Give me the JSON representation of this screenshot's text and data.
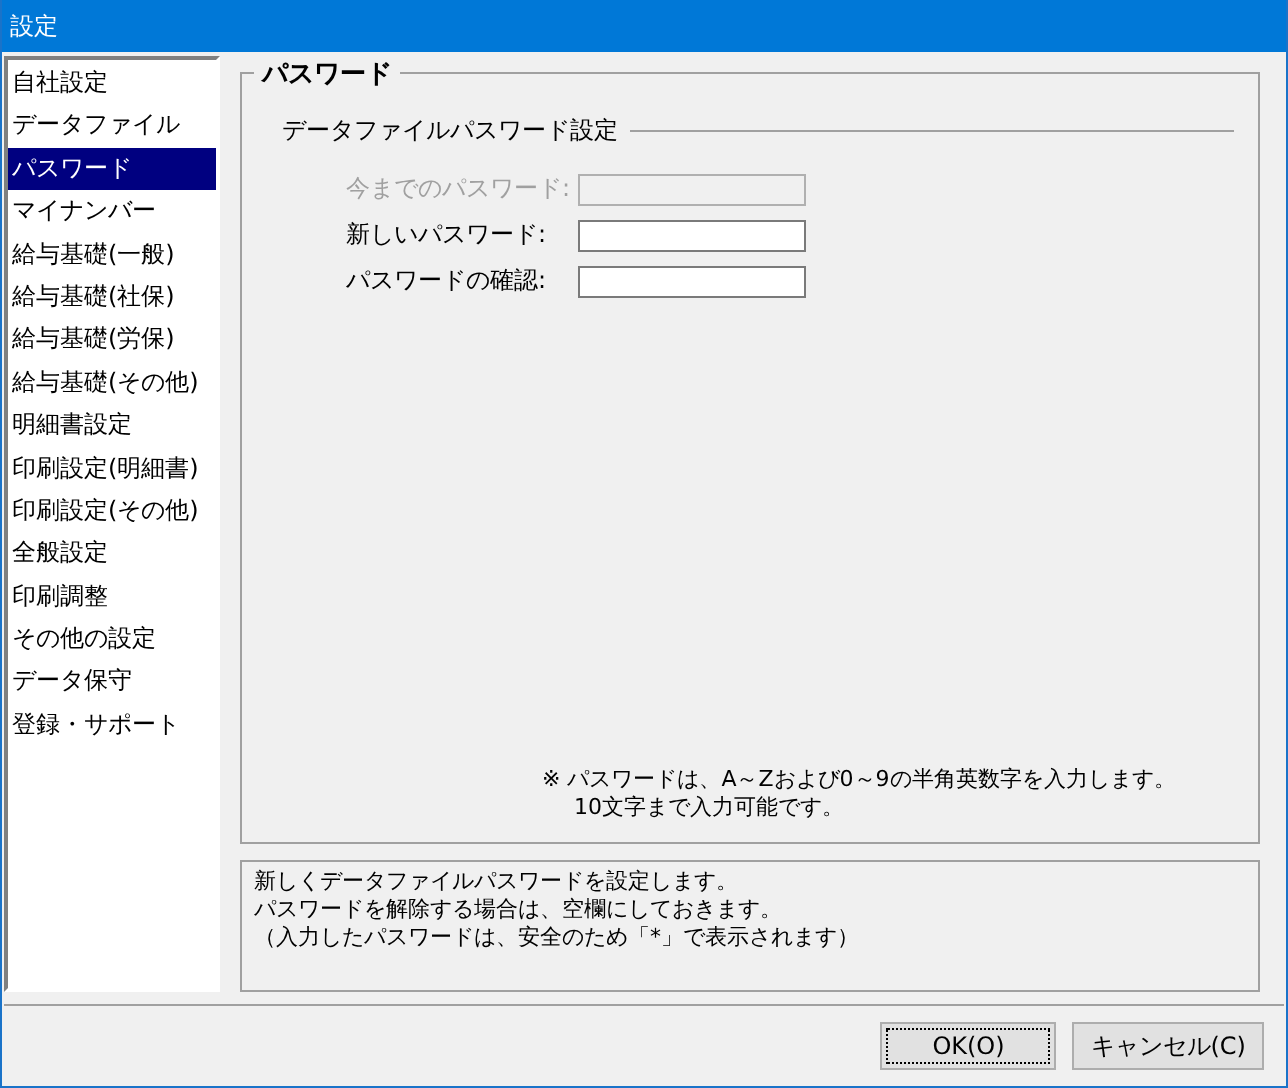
{
  "window": {
    "title": "設定"
  },
  "sidebar": {
    "items": [
      {
        "label": "自社設定",
        "selected": false
      },
      {
        "label": "データファイル",
        "selected": false
      },
      {
        "label": "パスワード",
        "selected": true
      },
      {
        "label": "マイナンバー",
        "selected": false
      },
      {
        "label": "給与基礎(一般)",
        "selected": false
      },
      {
        "label": "給与基礎(社保)",
        "selected": false
      },
      {
        "label": "給与基礎(労保)",
        "selected": false
      },
      {
        "label": "給与基礎(その他)",
        "selected": false
      },
      {
        "label": "明細書設定",
        "selected": false
      },
      {
        "label": "印刷設定(明細書)",
        "selected": false
      },
      {
        "label": "印刷設定(その他)",
        "selected": false
      },
      {
        "label": "全般設定",
        "selected": false
      },
      {
        "label": "印刷調整",
        "selected": false
      },
      {
        "label": "その他の設定",
        "selected": false
      },
      {
        "label": "データ保守",
        "selected": false
      },
      {
        "label": "登録・サポート",
        "selected": false
      }
    ]
  },
  "group": {
    "title": "パスワード",
    "section": "データファイルパスワード設定",
    "fields": [
      {
        "label": "今までのパスワード:",
        "disabled": true
      },
      {
        "label": "新しいパスワード:",
        "disabled": false
      },
      {
        "label": "パスワードの確認:",
        "disabled": false
      }
    ],
    "note": [
      "※ パスワードは、A～Zおよび0～9の半角英数字を入力します。",
      "10文字まで入力可能です。"
    ]
  },
  "description": [
    "新しくデータファイルパスワードを設定します。",
    "パスワードを解除する場合は、空欄にしておきます。",
    "（入力したパスワードは、安全のため「*」で表示されます）"
  ],
  "buttons": [
    {
      "label": "OK(O)",
      "focused": true
    },
    {
      "label": "キャンセル(C)",
      "focused": false
    }
  ]
}
